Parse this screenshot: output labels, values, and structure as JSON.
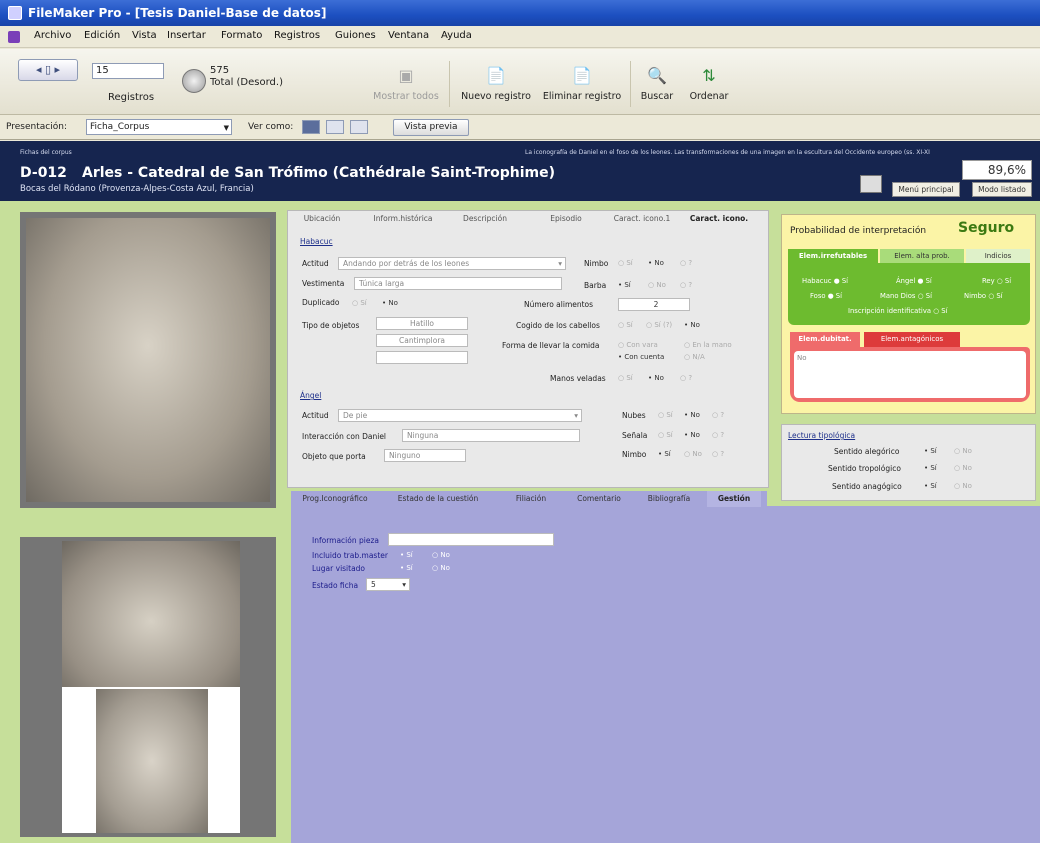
{
  "window": {
    "title": "FileMaker Pro - [Tesis Daniel-Base de datos]"
  },
  "menu": [
    "Archivo",
    "Edición",
    "Vista",
    "Insertar",
    "Formato",
    "Registros",
    "Guiones",
    "Ventana",
    "Ayuda"
  ],
  "toolbar": {
    "record_number": "15",
    "records_label": "Registros",
    "total_count": "575",
    "total_label": "Total (Desord.)",
    "buttons": {
      "show_all": "Mostrar todos",
      "new": "Nuevo registro",
      "delete": "Eliminar registro",
      "find": "Buscar",
      "sort": "Ordenar"
    }
  },
  "layoutbar": {
    "label": "Presentación:",
    "layout": "Ficha_Corpus",
    "view_as": "Ver como:",
    "preview": "Vista previa"
  },
  "header": {
    "section": "Fichas del corpus",
    "subtitle": "La iconografía de Daniel en el foso de los leones. Las transformaciones de una imagen en la escultura del Occidente europeo (ss. XI-XI",
    "code": "D-012",
    "title": "Arles - Catedral de San Trófimo (Cathédrale Saint-Trophime)",
    "place": "Bocas del Ródano (Provenza-Alpes-Costa Azul, Francia)",
    "percent": "89,6%",
    "menu_button": "Menú principal",
    "list_button": "Modo listado"
  },
  "tabs": [
    "Ubicación",
    "Inform.histórica",
    "Descripción",
    "Episodio",
    "Caract. icono.1",
    "Caract. icono."
  ],
  "habacuc": {
    "heading": "Habacuc",
    "actitud_label": "Actitud",
    "actitud": "Andando por detrás de los leones",
    "vestimenta_label": "Vestimenta",
    "vestimenta": "Túnica larga",
    "duplicado_label": "Duplicado",
    "si": "Sí",
    "no": "No",
    "nimbo_label": "Nimbo",
    "barba_label": "Barba",
    "q": "?",
    "numero_label": "Número alimentos",
    "numero": "2",
    "tipo_label": "Tipo de objetos",
    "tipo1": "Hatillo",
    "tipo2": "Cantimplora",
    "cogido_label": "Cogido de los cabellos",
    "si7": "Sí (?)",
    "forma_label": "Forma de llevar la comida",
    "vara": "Con vara",
    "mano": "En la mano",
    "cuenta": "Con cuenta",
    "na": "N/A",
    "manos_label": "Manos veladas"
  },
  "angel": {
    "heading": "Ángel",
    "actitud_label": "Actitud",
    "actitud": "De pie",
    "inter_label": "Interacción con Daniel",
    "inter": "Ninguna",
    "objeto_label": "Objeto que porta",
    "objeto": "Ninguno",
    "nubes_label": "Nubes",
    "senala_label": "Señala",
    "nimbo_label": "Nimbo"
  },
  "right": {
    "prob_label": "Probabilidad de interpretación",
    "prob": "Seguro",
    "gtabs": [
      "Elem.irrefutables",
      "Elem. alta prob.",
      "Indicios"
    ],
    "g": {
      "habacuc": "Habacuc",
      "angel": "Ángel",
      "rey": "Rey",
      "foso": "Foso",
      "mano": "Mano Dios",
      "nimbo": "Nimbo",
      "inscripcion": "Inscripción identificativa",
      "si": "Sí"
    },
    "rtabs": [
      "Elem.dubitat.",
      "Elem.antagónicos"
    ],
    "dubitat": "No",
    "lectura": {
      "heading": "Lectura tipológica",
      "alegorico": "Sentido alegórico",
      "tropologico": "Sentido tropológico",
      "anagogico": "Sentido anagógico",
      "si": "Sí",
      "no": "No"
    }
  },
  "btabs": [
    "Prog.Iconográfico",
    "Estado de la cuestión",
    "Filiación",
    "Comentario",
    "Bibliografía",
    "Gestión"
  ],
  "gestion": {
    "info_label": "Información pieza",
    "trab_label": "Incluido trab.master",
    "lugar_label": "Lugar visitado",
    "estado_label": "Estado ficha",
    "estado": "5",
    "si": "Sí",
    "no": "No"
  }
}
